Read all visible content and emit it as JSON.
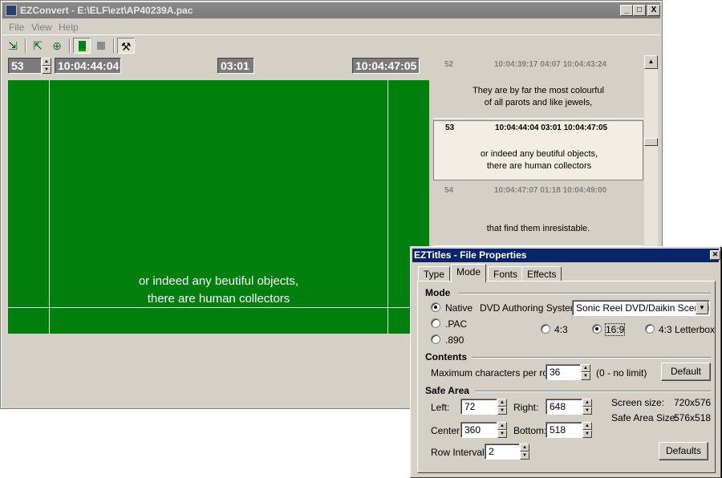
{
  "main": {
    "title": "EZConvert - E:\\ELF\\ezt\\AP40239A.pac",
    "menu": [
      "File",
      "View",
      "Help"
    ],
    "title_buttons": [
      "_",
      "□",
      "X"
    ],
    "timecode": {
      "subtitle_number": "53",
      "in": "10:04:44:04",
      "duration": "03:01",
      "out": "10:04:47:05"
    },
    "preview": {
      "lines": [
        "or indeed any beutiful objects,",
        "there are human collectors"
      ]
    },
    "subtitles": [
      {
        "num": "52",
        "in": "10:04:39:17",
        "dur": "04:07",
        "out": "10:04:43:24",
        "lines": [
          "They are by far the most colourful",
          "of all parots and like jewels,"
        ]
      },
      {
        "num": "53",
        "in": "10:04:44:04",
        "dur": "03:01",
        "out": "10:04:47:05",
        "lines": [
          "or indeed any beutiful objects,",
          "there are human collectors"
        ]
      },
      {
        "num": "54",
        "in": "10:04:47:07",
        "dur": "01:18",
        "out": "10:04:49:00",
        "lines": [
          "",
          "that find them inresistable."
        ]
      }
    ]
  },
  "dialog": {
    "title": "EZTitles - File Properties",
    "tabs": [
      "Type",
      "Mode",
      "Fonts",
      "Effects"
    ],
    "mode": {
      "heading": "Mode",
      "native": "Native",
      "pac": ".PAC",
      "890": ".890",
      "dvd_label": "DVD Authoring System:",
      "dvd_value": "Sonic Reel DVD/Daikin Scenarist",
      "ar_43": "4:3",
      "ar_169": "16:9",
      "ar_43lb": "4:3 Letterbox"
    },
    "contents": {
      "heading": "Contents",
      "max_chars_label": "Maximum characters per row:",
      "max_chars_value": "36",
      "hint": "(0 - no limit)",
      "default_button": "Default"
    },
    "safe_area": {
      "heading": "Safe Area",
      "left_label": "Left:",
      "left_value": "72",
      "right_label": "Right:",
      "right_value": "648",
      "center_label": "Center:",
      "center_value": "360",
      "bottom_label": "Bottom:",
      "bottom_value": "518",
      "screen_size_label": "Screen size:",
      "screen_size_value": "720x576",
      "safe_size_label": "Safe Area Size:",
      "safe_size_value": "576x518",
      "row_interval_label": "Row Interval:",
      "row_interval_value": "2",
      "defaults_button": "Defaults"
    }
  }
}
